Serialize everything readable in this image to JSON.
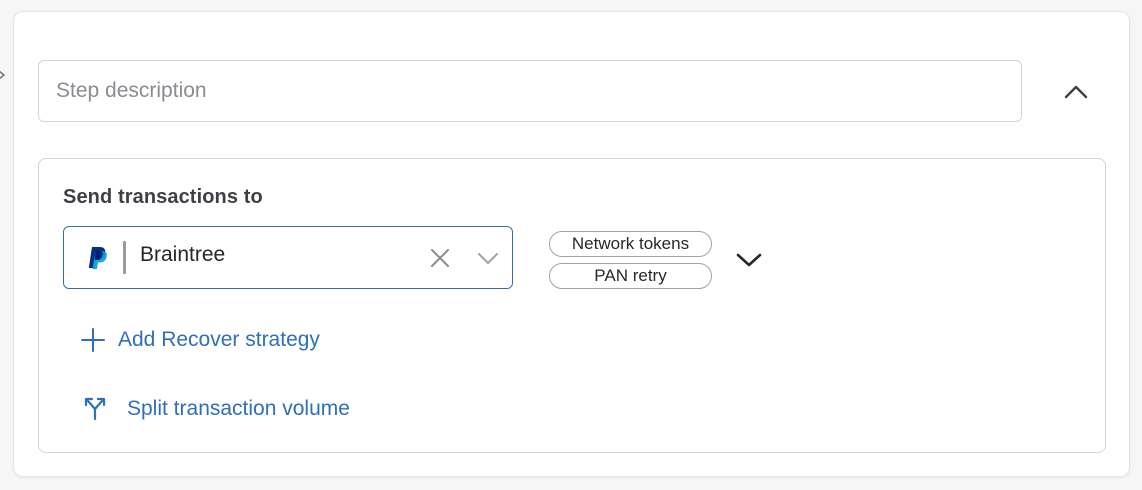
{
  "step": {
    "description_placeholder": "Step description",
    "description_value": ""
  },
  "routing": {
    "title": "Send transactions to",
    "selected_provider": "Braintree",
    "provider_icon": "paypal-logo",
    "features": [
      "Network tokens",
      "PAN retry"
    ]
  },
  "actions": {
    "add_recover": "Add Recover strategy",
    "split_volume": "Split transaction volume"
  },
  "colors": {
    "accent": "#2f6fb8",
    "paypal_dark": "#003087",
    "paypal_light": "#009cde"
  }
}
